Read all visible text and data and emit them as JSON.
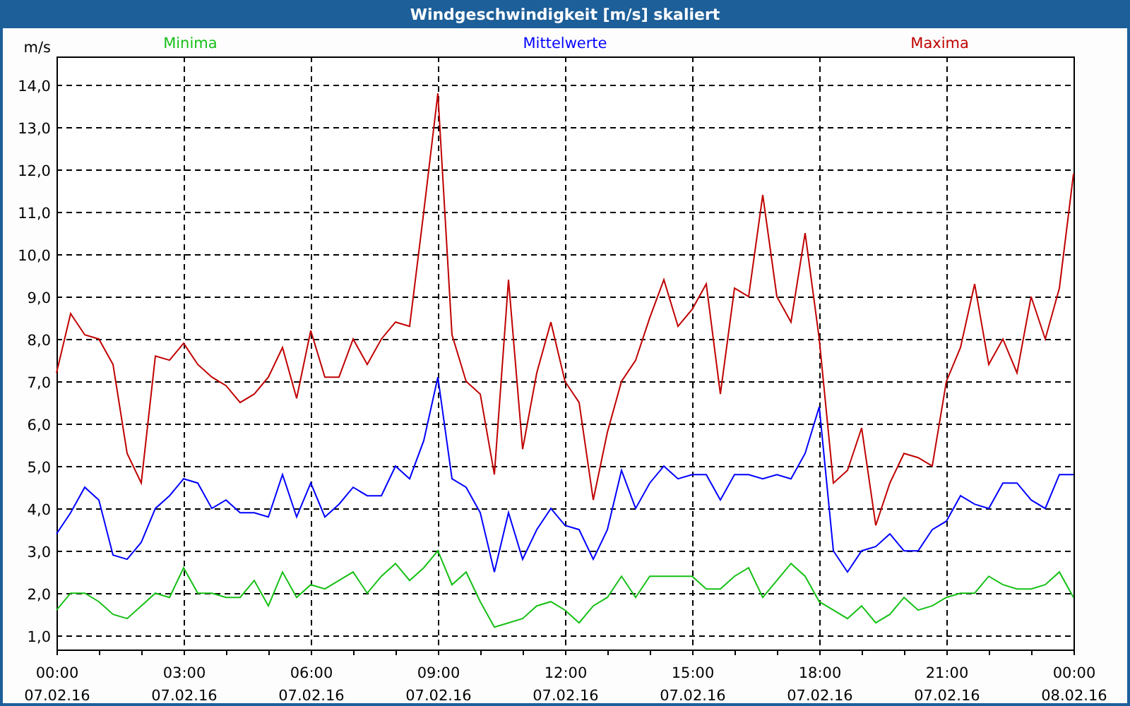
{
  "window": {
    "title": "Windgeschwindigkeit [m/s] skaliert"
  },
  "chart": {
    "chart_data": {
      "type": "line",
      "grid": true,
      "ylabel": "m/s",
      "ylim": [
        0.67,
        14.67
      ],
      "categories": [
        "00:00\n07.02.16",
        null,
        null,
        null,
        null,
        null,
        null,
        null,
        null,
        "03:00\n07.02.16",
        null,
        null,
        null,
        null,
        null,
        null,
        null,
        null,
        "06:00\n07.02.16",
        null,
        null,
        null,
        null,
        null,
        null,
        null,
        null,
        "09:00\n07.02.16",
        null,
        null,
        null,
        null,
        null,
        null,
        null,
        null,
        "12:00\n07.02.16",
        null,
        null,
        null,
        null,
        null,
        null,
        null,
        null,
        "15:00\n07.02.16",
        null,
        null,
        null,
        null,
        null,
        null,
        null,
        null,
        "18:00\n07.02.16",
        null,
        null,
        null,
        null,
        null,
        null,
        null,
        null,
        "21:00\n07.02.16",
        null,
        null,
        null,
        null,
        null,
        null,
        null,
        null,
        "00:00\n08.02.16"
      ],
      "series": [
        {
          "name": "Minima",
          "color": "#16c016",
          "values": [
            1.6,
            2.0,
            2.0,
            1.8,
            1.5,
            1.4,
            1.7,
            2.0,
            1.9,
            2.6,
            2.0,
            2.0,
            1.9,
            1.9,
            2.3,
            1.7,
            2.5,
            1.9,
            2.2,
            2.1,
            2.3,
            2.5,
            2.0,
            2.4,
            2.7,
            2.3,
            2.6,
            3.0,
            2.2,
            2.5,
            1.8,
            1.2,
            1.3,
            1.4,
            1.7,
            1.8,
            1.6,
            1.3,
            1.7,
            1.9,
            2.4,
            1.9,
            2.4,
            2.4,
            2.4,
            2.4,
            2.1,
            2.1,
            2.4,
            2.6,
            1.9,
            2.3,
            2.7,
            2.4,
            1.8,
            1.6,
            1.4,
            1.7,
            1.3,
            1.5,
            1.9,
            1.6,
            1.7,
            1.9,
            2.0,
            2.0,
            2.4,
            2.2,
            2.1,
            2.1,
            2.2,
            2.5,
            1.9
          ]
        },
        {
          "name": "Mittelwerte",
          "color": "#0000ff",
          "values": [
            3.4,
            3.9,
            4.5,
            4.2,
            2.9,
            2.8,
            3.2,
            4.0,
            4.3,
            4.7,
            4.6,
            4.0,
            4.2,
            3.9,
            3.9,
            3.8,
            4.8,
            3.8,
            4.6,
            3.8,
            4.1,
            4.5,
            4.3,
            4.3,
            5.0,
            4.7,
            5.6,
            7.1,
            4.7,
            4.5,
            3.9,
            2.5,
            3.9,
            2.8,
            3.5,
            4.0,
            3.6,
            3.5,
            2.8,
            3.5,
            4.9,
            4.0,
            4.6,
            5.0,
            4.7,
            4.8,
            4.8,
            4.2,
            4.8,
            4.8,
            4.7,
            4.8,
            4.7,
            5.3,
            6.4,
            3.0,
            2.5,
            3.0,
            3.1,
            3.4,
            3.0,
            3.0,
            3.5,
            3.7,
            4.3,
            4.1,
            4.0,
            4.6,
            4.6,
            4.2,
            4.0,
            4.8,
            4.8
          ]
        },
        {
          "name": "Maxima",
          "color": "#c00000",
          "values": [
            7.2,
            8.6,
            8.1,
            8.0,
            7.4,
            5.3,
            4.6,
            7.6,
            7.5,
            7.9,
            7.4,
            7.1,
            6.9,
            6.5,
            6.7,
            7.1,
            7.8,
            6.6,
            8.2,
            7.1,
            7.1,
            8.0,
            7.4,
            8.0,
            8.4,
            8.3,
            11.0,
            13.8,
            8.1,
            7.0,
            6.7,
            4.8,
            9.4,
            5.4,
            7.2,
            8.4,
            7.0,
            6.5,
            4.2,
            5.8,
            7.0,
            7.5,
            8.5,
            9.4,
            8.3,
            8.7,
            9.3,
            6.7,
            9.2,
            9.0,
            11.4,
            9.0,
            8.4,
            10.5,
            8.0,
            4.6,
            4.9,
            5.9,
            3.6,
            4.6,
            5.3,
            5.2,
            5.0,
            7.0,
            7.8,
            9.3,
            7.4,
            8.0,
            7.2,
            9.0,
            8.0,
            9.2,
            11.9
          ]
        }
      ],
      "yticks": [
        {
          "value": 1,
          "label": "1,0"
        },
        {
          "value": 2,
          "label": "2,0"
        },
        {
          "value": 3,
          "label": "3,0"
        },
        {
          "value": 4,
          "label": "4,0"
        },
        {
          "value": 5,
          "label": "5,0"
        },
        {
          "value": 6,
          "label": "6,0"
        },
        {
          "value": 7,
          "label": "7,0"
        },
        {
          "value": 8,
          "label": "8,0"
        },
        {
          "value": 9,
          "label": "9,0"
        },
        {
          "value": 10,
          "label": "10,0"
        },
        {
          "value": 11,
          "label": "11,0"
        },
        {
          "value": 12,
          "label": "12,0"
        },
        {
          "value": 13,
          "label": "13,0"
        },
        {
          "value": 14,
          "label": "14,0"
        }
      ]
    }
  }
}
